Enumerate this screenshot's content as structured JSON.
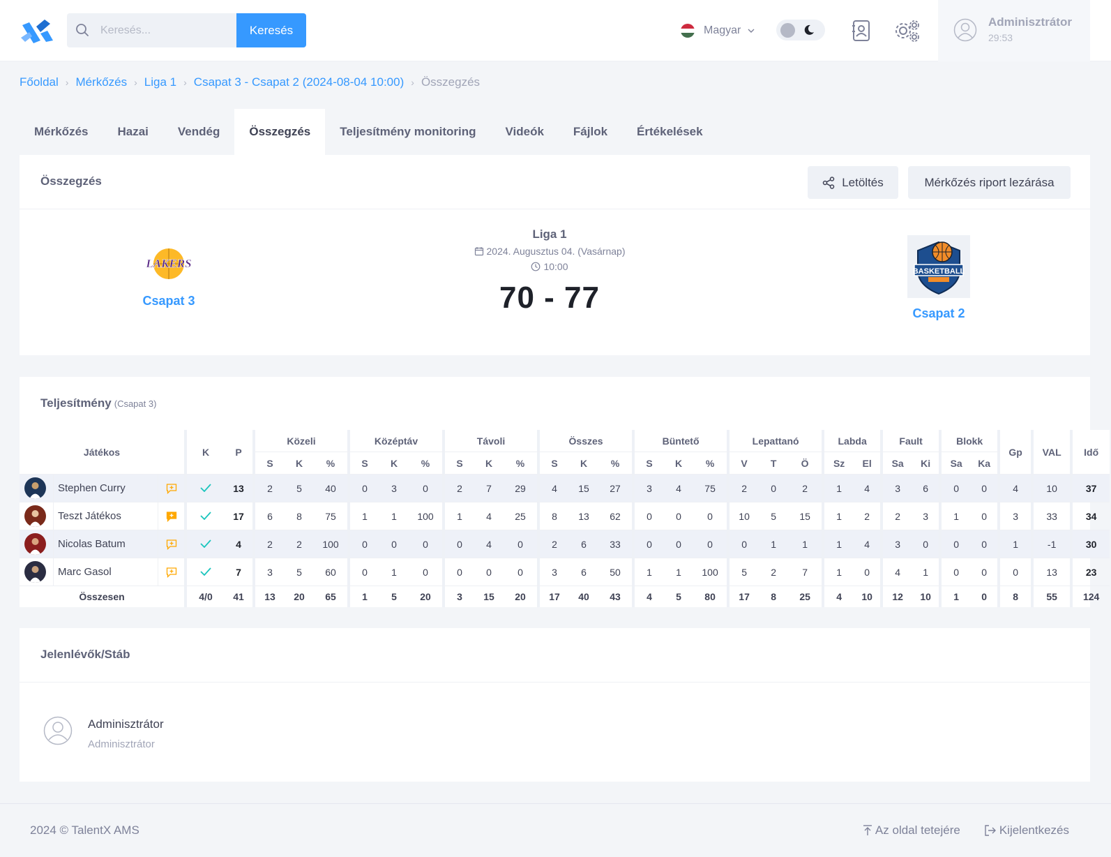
{
  "header": {
    "search_placeholder": "Keresés...",
    "search_button": "Keresés",
    "language": "Magyar",
    "user_name": "Adminisztrátor",
    "session_time": "29:53"
  },
  "breadcrumb": [
    "Főoldal",
    "Mérkőzés",
    "Liga 1",
    "Csapat 3 - Csapat 2 (2024-08-04 10:00)",
    "Összegzés"
  ],
  "tabs": [
    "Mérkőzés",
    "Hazai",
    "Vendég",
    "Összegzés",
    "Teljesítmény monitoring",
    "Videók",
    "Fájlok",
    "Értékelések"
  ],
  "active_tab": "Összegzés",
  "summary": {
    "title": "Összegzés",
    "download_button": "Letöltés",
    "close_report_button": "Mérkőzés riport lezárása",
    "home_team": "Csapat 3",
    "away_team": "Csapat 2",
    "league": "Liga 1",
    "date": "2024. Augusztus 04. (Vasárnap)",
    "time": "10:00",
    "score": "70 - 77",
    "home_logo_text": "LAKERS",
    "away_logo_text": "BASKETBALL"
  },
  "performance": {
    "title": "Teljesítmény",
    "team_note": "(Csapat 3)",
    "player_header": "Játékos",
    "k_header": "K",
    "p_header": "P",
    "groups": [
      {
        "name": "Közeli",
        "cols": [
          "S",
          "K",
          "%"
        ]
      },
      {
        "name": "Középtáv",
        "cols": [
          "S",
          "K",
          "%"
        ]
      },
      {
        "name": "Távoli",
        "cols": [
          "S",
          "K",
          "%"
        ]
      },
      {
        "name": "Összes",
        "cols": [
          "S",
          "K",
          "%"
        ]
      },
      {
        "name": "Büntető",
        "cols": [
          "S",
          "K",
          "%"
        ]
      },
      {
        "name": "Lepattanó",
        "cols": [
          "V",
          "T",
          "Ö"
        ]
      },
      {
        "name": "Labda",
        "cols": [
          "Sz",
          "El"
        ]
      },
      {
        "name": "Fault",
        "cols": [
          "Sa",
          "Ki"
        ]
      },
      {
        "name": "Blokk",
        "cols": [
          "Sa",
          "Ka"
        ]
      }
    ],
    "tail_headers": [
      "Gp",
      "VAL",
      "Idő"
    ],
    "players": [
      {
        "name": "Stephen Curry",
        "p": "13",
        "stats": [
          "2",
          "5",
          "40",
          "0",
          "3",
          "0",
          "2",
          "7",
          "29",
          "4",
          "15",
          "27",
          "3",
          "4",
          "75",
          "2",
          "0",
          "2",
          "1",
          "4",
          "3",
          "6",
          "0",
          "0"
        ],
        "gp": "4",
        "val": "10",
        "ido": "37"
      },
      {
        "name": "Teszt Játékos",
        "p": "17",
        "stats": [
          "6",
          "8",
          "75",
          "1",
          "1",
          "100",
          "1",
          "4",
          "25",
          "8",
          "13",
          "62",
          "0",
          "0",
          "0",
          "10",
          "5",
          "15",
          "1",
          "2",
          "2",
          "3",
          "1",
          "0"
        ],
        "gp": "3",
        "val": "33",
        "ido": "34"
      },
      {
        "name": "Nicolas Batum",
        "p": "4",
        "stats": [
          "2",
          "2",
          "100",
          "0",
          "0",
          "0",
          "0",
          "4",
          "0",
          "2",
          "6",
          "33",
          "0",
          "0",
          "0",
          "0",
          "1",
          "1",
          "1",
          "4",
          "3",
          "0",
          "0",
          "0"
        ],
        "gp": "1",
        "val": "-1",
        "ido": "30"
      },
      {
        "name": "Marc Gasol",
        "p": "7",
        "stats": [
          "3",
          "5",
          "60",
          "0",
          "1",
          "0",
          "0",
          "0",
          "0",
          "3",
          "6",
          "50",
          "1",
          "1",
          "100",
          "5",
          "2",
          "7",
          "1",
          "0",
          "4",
          "1",
          "0",
          "0"
        ],
        "gp": "0",
        "val": "13",
        "ido": "23"
      }
    ],
    "total": {
      "label": "Összesen",
      "k": "4/0",
      "p": "41",
      "stats": [
        "13",
        "20",
        "65",
        "1",
        "5",
        "20",
        "3",
        "15",
        "20",
        "17",
        "40",
        "43",
        "4",
        "5",
        "80",
        "17",
        "8",
        "25",
        "4",
        "10",
        "12",
        "10",
        "1",
        "0"
      ],
      "gp": "8",
      "val": "55",
      "ido": "124"
    }
  },
  "staff": {
    "title": "Jelenlévők/Stáb",
    "name": "Adminisztrátor",
    "role": "Adminisztrátor"
  },
  "footer": {
    "copyright": "2024 © TalentX AMS",
    "to_top": "Az oldal tetejére",
    "logout": "Kijelentkezés"
  },
  "colors": {
    "accent": "#3699ff",
    "check": "#1bc5bd",
    "comment": "#ffa800"
  }
}
